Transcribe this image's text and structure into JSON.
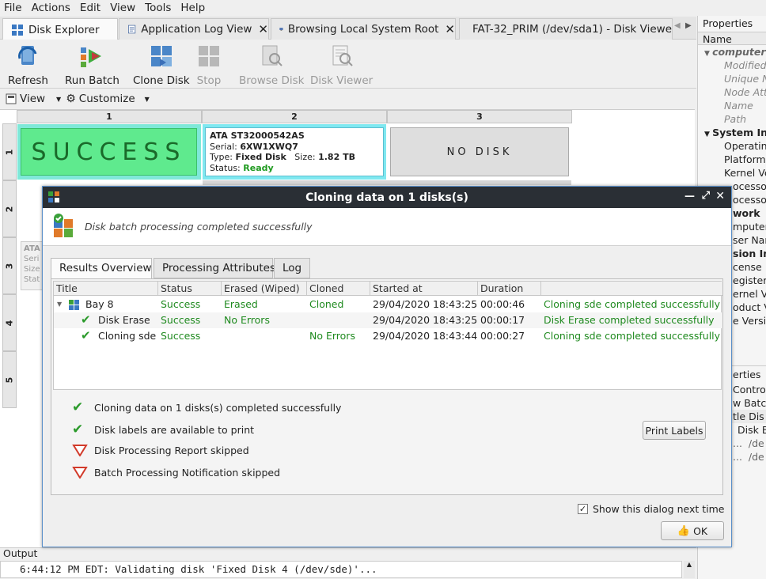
{
  "menu": [
    "File",
    "Actions",
    "Edit",
    "View",
    "Tools",
    "Help"
  ],
  "tabs": [
    {
      "label": "Disk Explorer",
      "closable": false
    },
    {
      "label": "Application Log View",
      "closable": true
    },
    {
      "label": "Browsing Local System Root",
      "closable": true
    },
    {
      "label": "FAT-32_PRIM (/dev/sda1) - Disk Viewer",
      "closable": false
    }
  ],
  "toolbar": {
    "refresh": "Refresh",
    "run_batch": "Run Batch",
    "clone_disk": "Clone Disk",
    "stop": "Stop",
    "browse_disk": "Browse Disk",
    "disk_viewer": "Disk Viewer"
  },
  "viewbar": {
    "view": "View",
    "customize": "Customize"
  },
  "grid": {
    "columns": [
      "1",
      "2",
      "3"
    ],
    "rows": [
      "1",
      "2",
      "3",
      "4",
      "5"
    ],
    "success_text": "SUCCESS",
    "disk": {
      "model": "ATA ST32000542AS",
      "serial_label": "Serial:",
      "serial": "6XW1XWQ7",
      "type_label": "Type:",
      "type": "Fixed Disk",
      "size_label": "Size:",
      "size": "1.82 TB",
      "status_label": "Status:",
      "status": "Ready"
    },
    "no_disk": "NO DISK",
    "row3_partial": {
      "model": "ATA",
      "l1": "Seri",
      "l2": "Size",
      "l3": "Stat"
    }
  },
  "properties": {
    "title": "Properties",
    "col": "Name",
    "items": [
      "computer",
      "Modified",
      "Unique N",
      "Node Att",
      "Name",
      "Path",
      "System In",
      "Operatin",
      "Platform",
      "Kernel Ve",
      "ocesso",
      "ocesso",
      "work",
      "mputer",
      "ser Nam",
      "sion In",
      "cense",
      "egistere",
      "ernel Ve",
      "oduct V",
      "e Versi"
    ],
    "sub_title": "erties",
    "sub_items": [
      "Contro",
      "w Batch",
      "tle",
      "Dis",
      "Disk B",
      "...",
      "/de",
      "...",
      "/de"
    ]
  },
  "output": {
    "title": "Output",
    "line": "6:44:12 PM EDT: Validating disk 'Fixed Disk 4 (/dev/sde)'..."
  },
  "dialog": {
    "title": "Cloning data on 1 disks(s)",
    "header": "Disk batch processing completed successfully",
    "tabs": [
      "Results Overview",
      "Processing Attributes",
      "Log"
    ],
    "columns": [
      "Title",
      "Status",
      "Erased (Wiped)",
      "Cloned",
      "Started at",
      "Duration",
      ""
    ],
    "rows": [
      {
        "title": "Bay 8",
        "status": "Success",
        "erased": "Erased",
        "cloned": "Cloned",
        "started": "29/04/2020 18:43:25",
        "duration": "00:00:46",
        "message": "Cloning sde completed successfully"
      },
      {
        "title": "Disk Erase",
        "status": "Success",
        "erased": "No Errors",
        "cloned": "",
        "started": "29/04/2020 18:43:25",
        "duration": "00:00:17",
        "message": "Disk Erase completed successfully"
      },
      {
        "title": "Cloning sde",
        "status": "Success",
        "erased": "",
        "cloned": "No Errors",
        "started": "29/04/2020 18:43:44",
        "duration": "00:00:27",
        "message": "Cloning sde completed successfully"
      }
    ],
    "summary": [
      {
        "text": "Cloning data on 1 disks(s) completed successfully",
        "ok": true
      },
      {
        "text": "Disk labels are available to print",
        "ok": true
      },
      {
        "text": "Disk Processing Report skipped",
        "ok": false
      },
      {
        "text": "Batch Processing Notification skipped",
        "ok": false
      }
    ],
    "print_labels": "Print Labels",
    "show_next": "Show this dialog next time",
    "ok": "OK"
  }
}
